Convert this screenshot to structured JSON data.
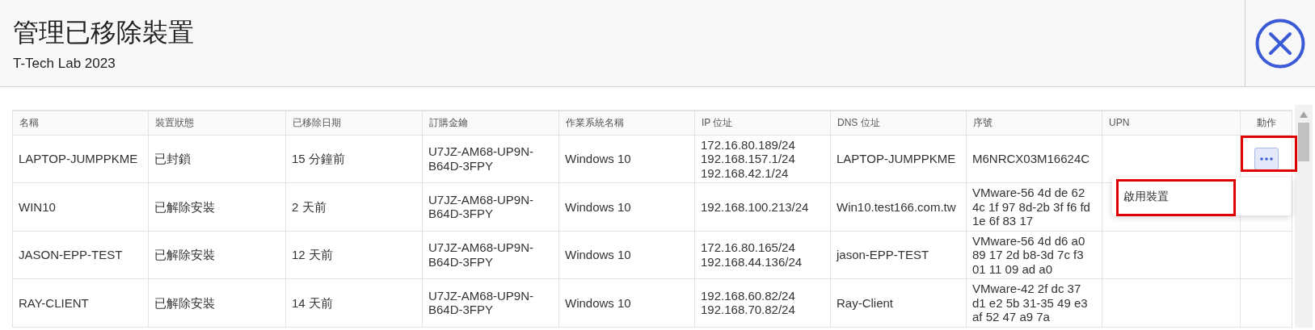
{
  "header": {
    "title": "管理已移除裝置",
    "subtitle": "T-Tech Lab 2023"
  },
  "table": {
    "columns": [
      "名稱",
      "裝置狀態",
      "已移除日期",
      "訂購金鑰",
      "作業系統名稱",
      "IP 位址",
      "DNS 位址",
      "序號",
      "UPN",
      "動作"
    ],
    "rows": [
      {
        "cells": [
          "LAPTOP-JUMPPKME",
          "已封鎖",
          "15 分鐘前",
          "U7JZ-AM68-UP9N-B64D-3FPY",
          "Windows 10",
          "172.16.80.189/24\n192.168.157.1/24\n192.168.42.1/24",
          "LAPTOP-JUMPPKME",
          "M6NRCX03M16624C",
          ""
        ],
        "action_button": {
          "expanded": true,
          "highlighted": true
        }
      },
      {
        "cells": [
          "WIN10",
          "已解除安裝",
          "2 天前",
          "U7JZ-AM68-UP9N-B64D-3FPY",
          "Windows 10",
          "192.168.100.213/24",
          "Win10.test166.com.tw",
          "VMware-56 4d de 62 4c 1f 97 8d-2b 3f f6 fd 1e 6f 83 17",
          ""
        ]
      },
      {
        "cells": [
          "JASON-EPP-TEST",
          "已解除安裝",
          "12 天前",
          "U7JZ-AM68-UP9N-B64D-3FPY",
          "Windows 10",
          "172.16.80.165/24\n192.168.44.136/24",
          "jason-EPP-TEST",
          "VMware-56 4d d6 a0 89 17 2d b8-3d 7c f3 01 11 09 ad a0",
          ""
        ]
      },
      {
        "cells": [
          "RAY-CLIENT",
          "已解除安裝",
          "14 天前",
          "U7JZ-AM68-UP9N-B64D-3FPY",
          "Windows 10",
          "192.168.60.82/24\n192.168.70.82/24",
          "Ray-Client",
          "VMware-42 2f dc 37 d1 e2 5b 31-35 49 e3 af 52 47 a9 7a",
          ""
        ]
      }
    ]
  },
  "action_menu": {
    "items": [
      {
        "label": "啟用裝置",
        "highlighted": true
      }
    ]
  }
}
